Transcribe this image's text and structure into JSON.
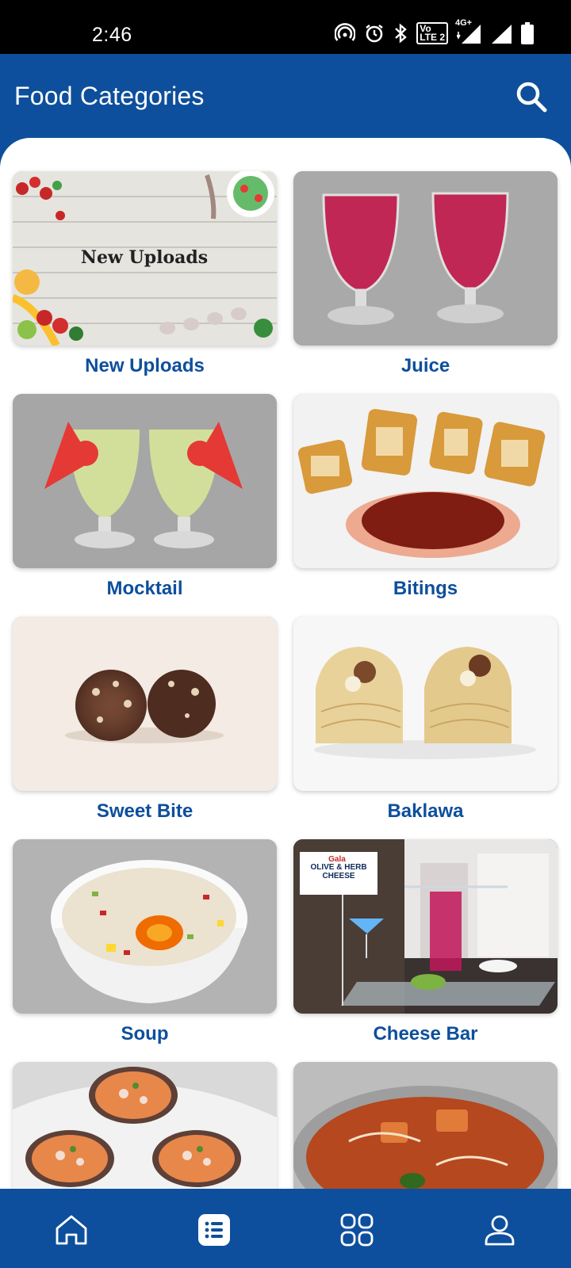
{
  "status": {
    "time": "2:46",
    "net": "4G+",
    "volte_line1": "Vo",
    "volte_line2": "LTE 2"
  },
  "app_bar": {
    "title": "Food Categories"
  },
  "categories": [
    {
      "label": "New Uploads",
      "banner_text": "New Uploads"
    },
    {
      "label": "Juice"
    },
    {
      "label": "Mocktail"
    },
    {
      "label": "Bitings"
    },
    {
      "label": "Sweet Bite"
    },
    {
      "label": "Baklawa"
    },
    {
      "label": "Soup"
    },
    {
      "label": "Cheese Bar",
      "sign_brand": "Gala",
      "sign_text": "OLIVE & HERB CHEESE"
    },
    {
      "label": ""
    },
    {
      "label": ""
    }
  ],
  "bottom_nav": {
    "items": [
      {
        "icon": "home-icon"
      },
      {
        "icon": "list-icon",
        "active": true
      },
      {
        "icon": "grid-icon"
      },
      {
        "icon": "profile-icon"
      }
    ]
  },
  "colors": {
    "brand": "#0d4f9c",
    "label": "#0d4f9c"
  }
}
